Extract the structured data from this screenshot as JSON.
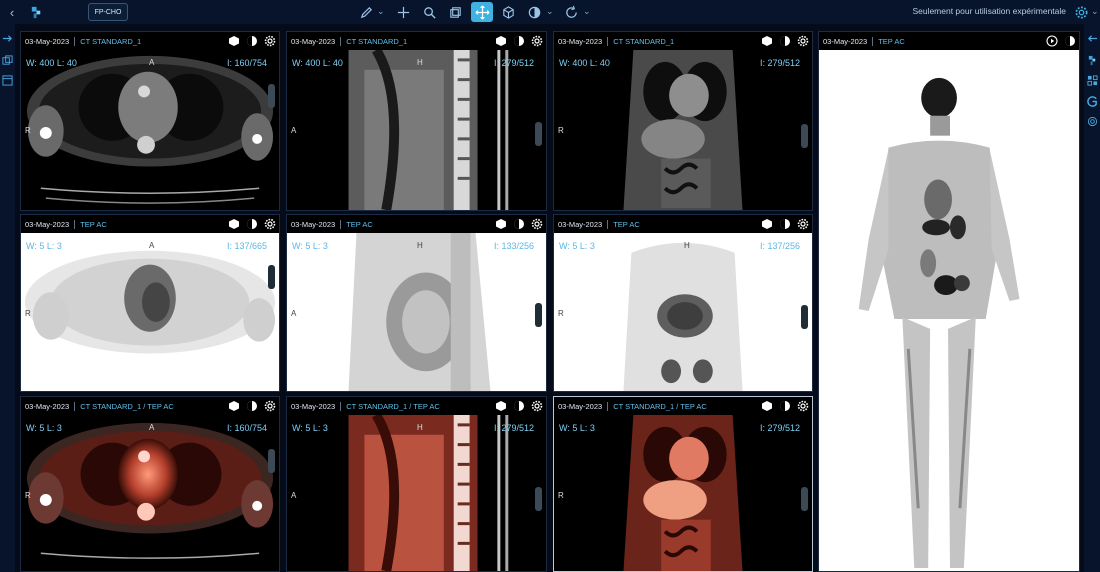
{
  "toolbar": {
    "patient_label": "FP-CHO",
    "disclaimer": "Seulement pour utilisation expérimentale",
    "icons": [
      "back-icon",
      "app-logo-icon",
      "pencil-icon",
      "crosshair-icon",
      "zoom-icon",
      "layers-icon",
      "pan-icon",
      "cube-icon",
      "contrast-icon",
      "rotate-icon",
      "settings-icon"
    ]
  },
  "viewports": [
    {
      "date": "03-May-2023",
      "series": "CT STANDARD_1",
      "wl": "W: 400  L: 40",
      "slice": "I: 160/754",
      "top": "A",
      "left": "R"
    },
    {
      "date": "03-May-2023",
      "series": "CT STANDARD_1",
      "wl": "W: 400  L: 40",
      "slice": "I: 279/512",
      "top": "H",
      "left": "A"
    },
    {
      "date": "03-May-2023",
      "series": "CT STANDARD_1",
      "wl": "W: 400  L: 40",
      "slice": "I: 279/512",
      "top": "",
      "left": "R"
    },
    {
      "date": "03-May-2023",
      "series": "TEP AC",
      "wl": "W: 5  L: 3",
      "slice": "I: 137/665",
      "top": "A",
      "left": "R"
    },
    {
      "date": "03-May-2023",
      "series": "TEP AC",
      "wl": "W: 5  L: 3",
      "slice": "I: 133/256",
      "top": "H",
      "left": "A"
    },
    {
      "date": "03-May-2023",
      "series": "TEP AC",
      "wl": "W: 5  L: 3",
      "slice": "I: 137/256",
      "top": "H",
      "left": "R"
    },
    {
      "date": "03-May-2023",
      "series": "CT STANDARD_1 / TEP AC",
      "wl": "W: 5  L: 3",
      "slice": "I: 160/754",
      "top": "A",
      "left": "R"
    },
    {
      "date": "03-May-2023",
      "series": "CT STANDARD_1 / TEP AC",
      "wl": "W: 5  L: 3",
      "slice": "I: 279/512",
      "top": "H",
      "left": "A"
    },
    {
      "date": "03-May-2023",
      "series": "CT STANDARD_1 / TEP AC",
      "wl": "W: 5  L: 3",
      "slice": "I: 279/512",
      "top": "",
      "left": "R"
    },
    {
      "date": "03-May-2023",
      "series": "TEP AC"
    }
  ],
  "colors": {
    "accent": "#3fb2e0",
    "series_text": "#5fc0ec",
    "overlay_text": "#7ed0f6",
    "background": "#050b18"
  }
}
